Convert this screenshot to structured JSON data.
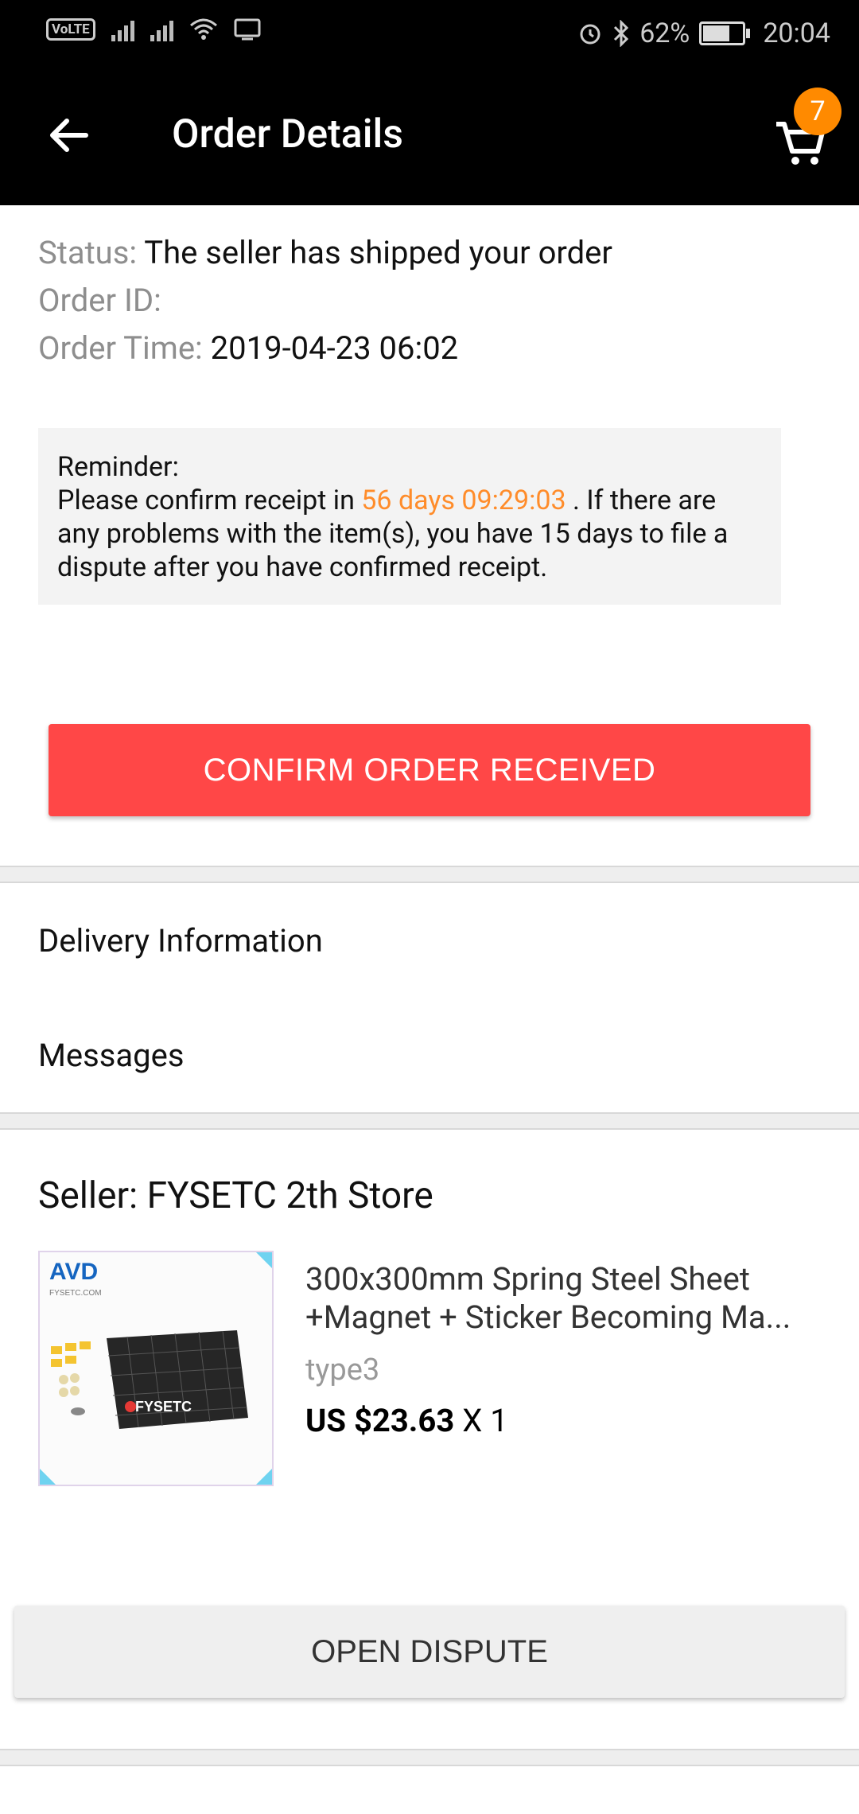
{
  "status_bar": {
    "volte": "VoLTE",
    "battery": "62%",
    "time": "20:04"
  },
  "header": {
    "title": "Order Details",
    "cart_count": "7"
  },
  "order": {
    "status_label": "Status:",
    "status_value": "The seller has shipped your order",
    "id_label": "Order ID:",
    "time_label": "Order Time:",
    "time_value": "2019-04-23 06:02"
  },
  "reminder": {
    "title": "Reminder:",
    "text_before": "Please confirm receipt in ",
    "countdown": "56 days 09:29:03",
    "text_after": " . If there are any problems with the item(s), you have 15 days to file a dispute after you have confirmed receipt."
  },
  "confirm_button": "CONFIRM ORDER RECEIVED",
  "links": {
    "delivery": "Delivery Information",
    "messages": "Messages"
  },
  "seller": {
    "label": "Seller: FYSETC 2th Store"
  },
  "product": {
    "title_line1": "300x300mm Spring Steel Sheet",
    "title_line2": "+Magnet + Sticker Becoming Ma...",
    "variant": "type3",
    "price": "US $23.63",
    "quantity": "X 1",
    "image_brand": "FYSETC",
    "image_site": "FYSETC.COM"
  },
  "dispute_button": "OPEN DISPUTE",
  "colors": {
    "accent_red": "#ff4747",
    "countdown_orange": "#ff8c2a",
    "badge_orange": "#ff8a00"
  }
}
